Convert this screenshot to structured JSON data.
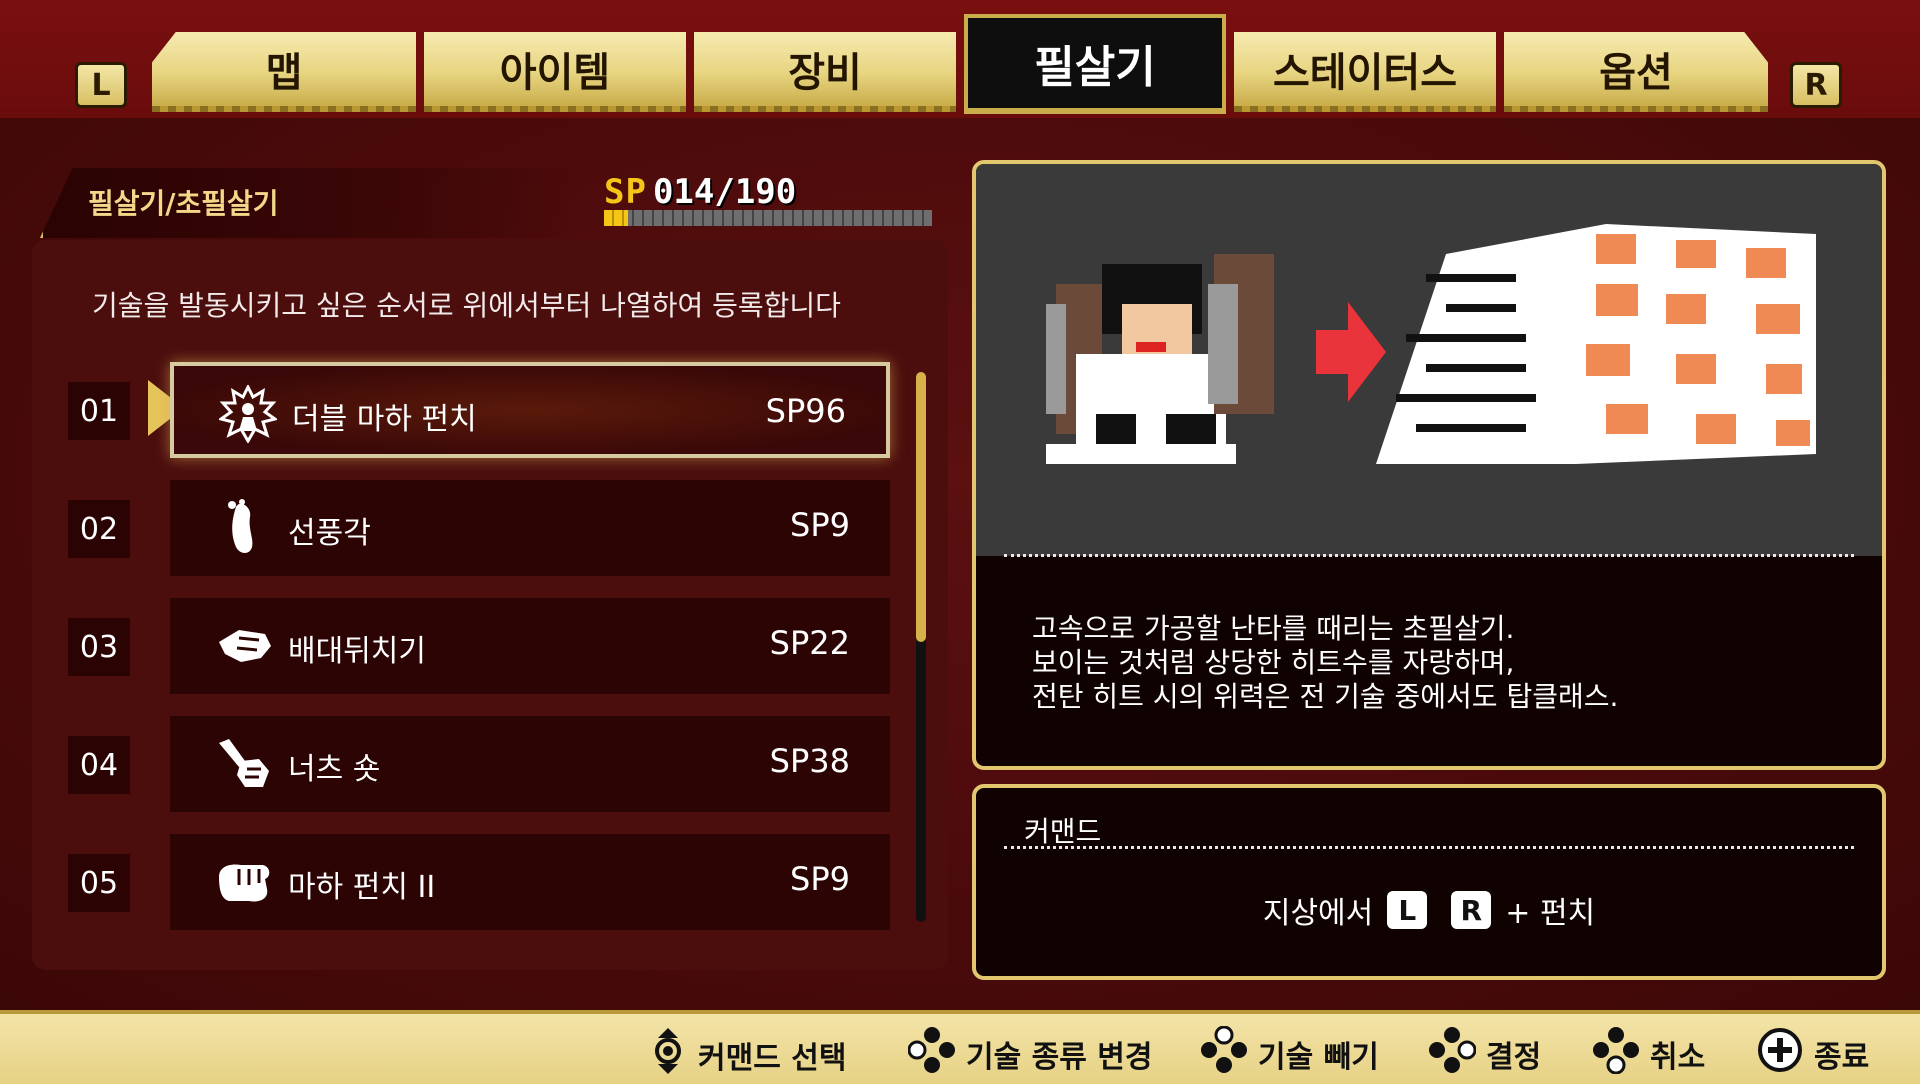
{
  "tabs": {
    "left_shoulder": "L",
    "right_shoulder": "R",
    "items": [
      {
        "label": "맵"
      },
      {
        "label": "아이템"
      },
      {
        "label": "장비"
      },
      {
        "label": "필살기"
      },
      {
        "label": "스테이터스"
      },
      {
        "label": "옵션"
      }
    ],
    "active": "필살기"
  },
  "category": "필살기/초필살기",
  "sp": {
    "key": "SP",
    "value": "014/190",
    "fraction": 0.074
  },
  "instruction": "기술을 발동시키고 싶은 순서로 위에서부터 나열하여 등록합니다",
  "moves": [
    {
      "num": "01",
      "name": "더블 마하 펀치",
      "cost": "SP96",
      "icon": "aura-fighter-icon",
      "selected": true
    },
    {
      "num": "02",
      "name": "선풍각",
      "cost": "SP9",
      "icon": "foot-icon",
      "selected": false
    },
    {
      "num": "03",
      "name": "배대뒤치기",
      "cost": "SP22",
      "icon": "throw-hand-icon",
      "selected": false
    },
    {
      "num": "04",
      "name": "너츠 숏",
      "cost": "SP38",
      "icon": "shot-hand-icon",
      "selected": false
    },
    {
      "num": "05",
      "name": "마하 펀치 II",
      "cost": "SP9",
      "icon": "fist-icon",
      "selected": false
    }
  ],
  "description": [
    "고속으로 가공할 난타를 때리는 초필살기.",
    "보이는 것처럼 상당한 히트수를 자랑하며,",
    "전탄 히트 시의 위력은 전 기술 중에서도 탑클래스."
  ],
  "command": {
    "title": "커맨드",
    "prefix": "지상에서",
    "key1": "L",
    "key2": "R",
    "suffix": "+ 펀치"
  },
  "hints": [
    {
      "label": "커맨드 선택",
      "icon": "dpad-updown-icon"
    },
    {
      "label": "기술 종류 변경",
      "icon": "face-buttons-left-icon"
    },
    {
      "label": "기술 빼기",
      "icon": "face-buttons-top-icon"
    },
    {
      "label": "결정",
      "icon": "face-buttons-right-icon"
    },
    {
      "label": "취소",
      "icon": "face-buttons-bottom-icon"
    },
    {
      "label": "종료",
      "icon": "plus-button-icon"
    }
  ],
  "colors": {
    "accent_gold": "#e2c76e",
    "sp_yellow": "#f5c518",
    "preview_arrow": "#e8343a"
  }
}
